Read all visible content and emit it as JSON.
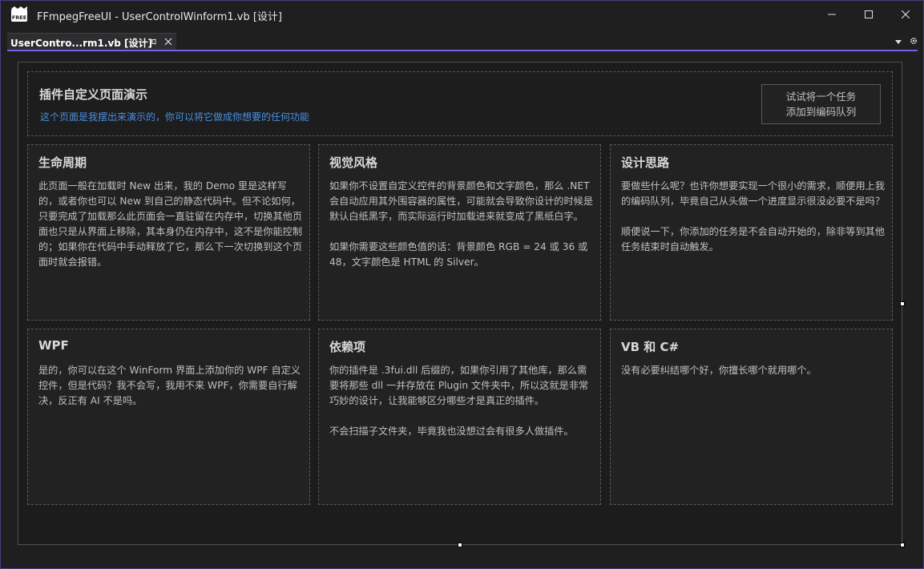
{
  "window": {
    "title": "FFmpegFreeUI - UserControlWinform1.vb [设计]"
  },
  "tab": {
    "label": "UserContro...rm1.vb [设计]"
  },
  "header": {
    "title": "插件自定义页面演示",
    "subtitle": "这个页面是我摆出来演示的，你可以将它做成你想要的任何功能",
    "button_line1": "试试将一个任务",
    "button_line2": "添加到编码队列"
  },
  "cards": [
    {
      "title": "生命周期",
      "paragraphs": [
        "此页面一般在加载时 New 出来，我的 Demo 里是这样写的，或者你也可以 New 到自己的静态代码中。但不论如何，只要完成了加载那么此页面会一直驻留在内存中，切换其他页面也只是从界面上移除，其本身仍在内存中，这不是你能控制的；如果你在代码中手动释放了它，那么下一次切换到这个页面时就会报错。"
      ]
    },
    {
      "title": "视觉风格",
      "paragraphs": [
        "如果你不设置自定义控件的背景颜色和文字颜色，那么 .NET 会自动应用其外围容器的属性，可能就会导致你设计的时候是默认白纸黑字，而实际运行时加载进来就变成了黑纸白字。",
        "如果你需要这些颜色值的话：背景颜色 RGB = 24 或 36 或 48，文字颜色是 HTML 的 Silver。"
      ]
    },
    {
      "title": "设计思路",
      "paragraphs": [
        "要做些什么呢？也许你想要实现一个很小的需求，顺便用上我的编码队列，毕竟自己从头做一个进度显示很没必要不是吗？",
        "顺便说一下，你添加的任务是不会自动开始的，除非等到其他任务结束时自动触发。"
      ]
    },
    {
      "title": "WPF",
      "paragraphs": [
        "是的，你可以在这个 WinForm 界面上添加你的 WPF 自定义控件，但是代码？我不会写，我用不来 WPF，你需要自行解决，反正有 AI 不是吗。"
      ]
    },
    {
      "title": "依赖项",
      "paragraphs": [
        "你的插件是 .3fui.dll 后缀的，如果你引用了其他库，那么需要将那些 dll 一并存放在 Plugin 文件夹中，所以这就是非常巧妙的设计，让我能够区分哪些才是真正的插件。",
        "不会扫描子文件夹，毕竟我也没想过会有很多人做插件。"
      ]
    },
    {
      "title": "VB 和 C#",
      "paragraphs": [
        "没有必要纠结哪个好，你擅长哪个就用哪个。"
      ]
    }
  ],
  "colors": {
    "accent": "#7160e8",
    "link_blue": "#4a90e2",
    "text_silver": "#c0c0c0",
    "background": "#1f1f1f"
  }
}
